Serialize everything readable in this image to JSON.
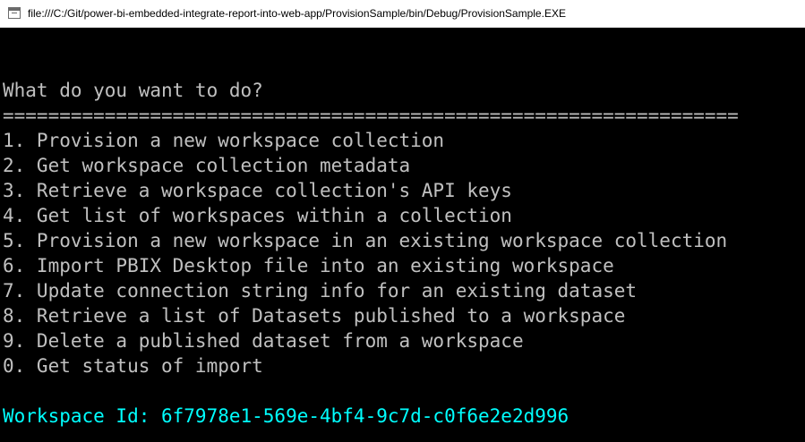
{
  "window": {
    "title": "file:///C:/Git/power-bi-embedded-integrate-report-into-web-app/ProvisionSample/bin/Debug/ProvisionSample.EXE"
  },
  "console": {
    "prompt": "What do you want to do?",
    "separator": "=================================================================",
    "options": [
      "1. Provision a new workspace collection",
      "2. Get workspace collection metadata",
      "3. Retrieve a workspace collection's API keys",
      "4. Get list of workspaces within a collection",
      "5. Provision a new workspace in an existing workspace collection",
      "6. Import PBIX Desktop file into an existing workspace",
      "7. Update connection string info for an existing dataset",
      "8. Retrieve a list of Datasets published to a workspace",
      "9. Delete a published dataset from a workspace",
      "0. Get status of import"
    ],
    "workspace_id_line": "Workspace Id: 6f7978e1-569e-4bf4-9c7d-c0f6e2e2d996"
  },
  "colors": {
    "background": "#000000",
    "text": "#c0c0c0",
    "accent": "#00ffff",
    "titlebar": "#ffffff"
  },
  "icons": {
    "app": "console-app-icon"
  }
}
